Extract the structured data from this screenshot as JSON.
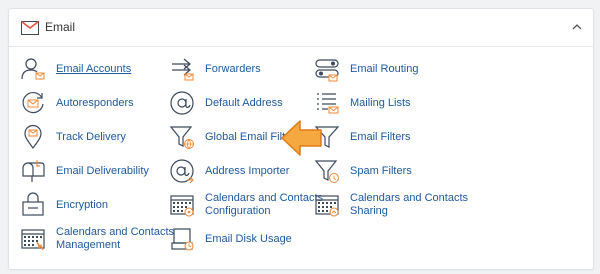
{
  "panel": {
    "title": "Email",
    "header_icon": "envelope-icon",
    "collapse_icon": "chevron-up-icon"
  },
  "items": [
    {
      "label": "Email Accounts",
      "icon": "user-envelope-icon"
    },
    {
      "label": "Forwarders",
      "icon": "forward-arrows-icon"
    },
    {
      "label": "Email Routing",
      "icon": "routing-icon"
    },
    {
      "label": "Autoresponders",
      "icon": "autoresponder-icon"
    },
    {
      "label": "Default Address",
      "icon": "at-sign-icon"
    },
    {
      "label": "Mailing Lists",
      "icon": "list-icon"
    },
    {
      "label": "Track Delivery",
      "icon": "location-pin-icon"
    },
    {
      "label": "Global Email Filters",
      "icon": "global-filter-icon"
    },
    {
      "label": "Email Filters",
      "icon": "filter-icon"
    },
    {
      "label": "Email Deliverability",
      "icon": "mailbox-icon"
    },
    {
      "label": "Address Importer",
      "icon": "address-import-icon"
    },
    {
      "label": "Spam Filters",
      "icon": "spam-filter-icon"
    },
    {
      "label": "Encryption",
      "icon": "encryption-icon"
    },
    {
      "label": "Calendars and Contacts Configuration",
      "icon": "calendar-config-icon"
    },
    {
      "label": "Calendars and Contacts Sharing",
      "icon": "calendar-sharing-icon"
    },
    {
      "label": "Calendars and Contacts Management",
      "icon": "calendar-management-icon"
    },
    {
      "label": "Email Disk Usage",
      "icon": "disk-usage-icon"
    }
  ],
  "colors": {
    "link": "#1f5aa0",
    "icon_stroke": "#3d4a5c",
    "accent": "#f08a38",
    "pointer_fill": "#f5a740",
    "pointer_stroke": "#e07b16"
  },
  "pointer": {
    "icon": "left-pointer-arrow-icon",
    "target": "Global Email Filters"
  }
}
